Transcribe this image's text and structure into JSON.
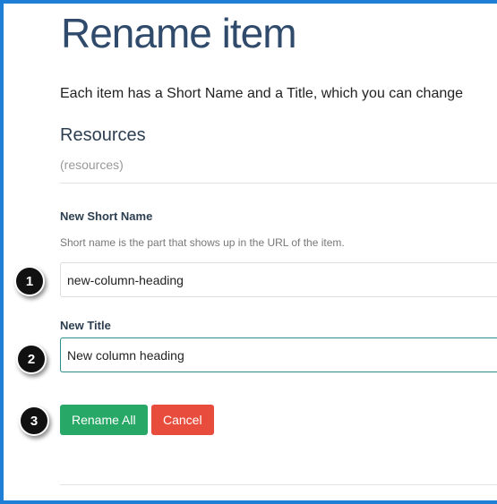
{
  "page": {
    "title": "Rename item",
    "intro": "Each item has a Short Name and a Title, which you can change"
  },
  "section": {
    "title": "Resources",
    "subtitle": "(resources)"
  },
  "short_name": {
    "label": "New Short Name",
    "help": "Short name is the part that shows up in the URL of the item.",
    "value": "new-column-heading"
  },
  "new_title": {
    "label": "New Title",
    "value": "New column heading"
  },
  "buttons": {
    "rename_all": "Rename All",
    "cancel": "Cancel"
  },
  "steps": [
    "1",
    "2",
    "3"
  ],
  "colors": {
    "frame_border": "#1f7fd6",
    "primary_button": "#27a867",
    "danger_button": "#e74c3c",
    "focused_input_border": "#2a8c8c"
  }
}
